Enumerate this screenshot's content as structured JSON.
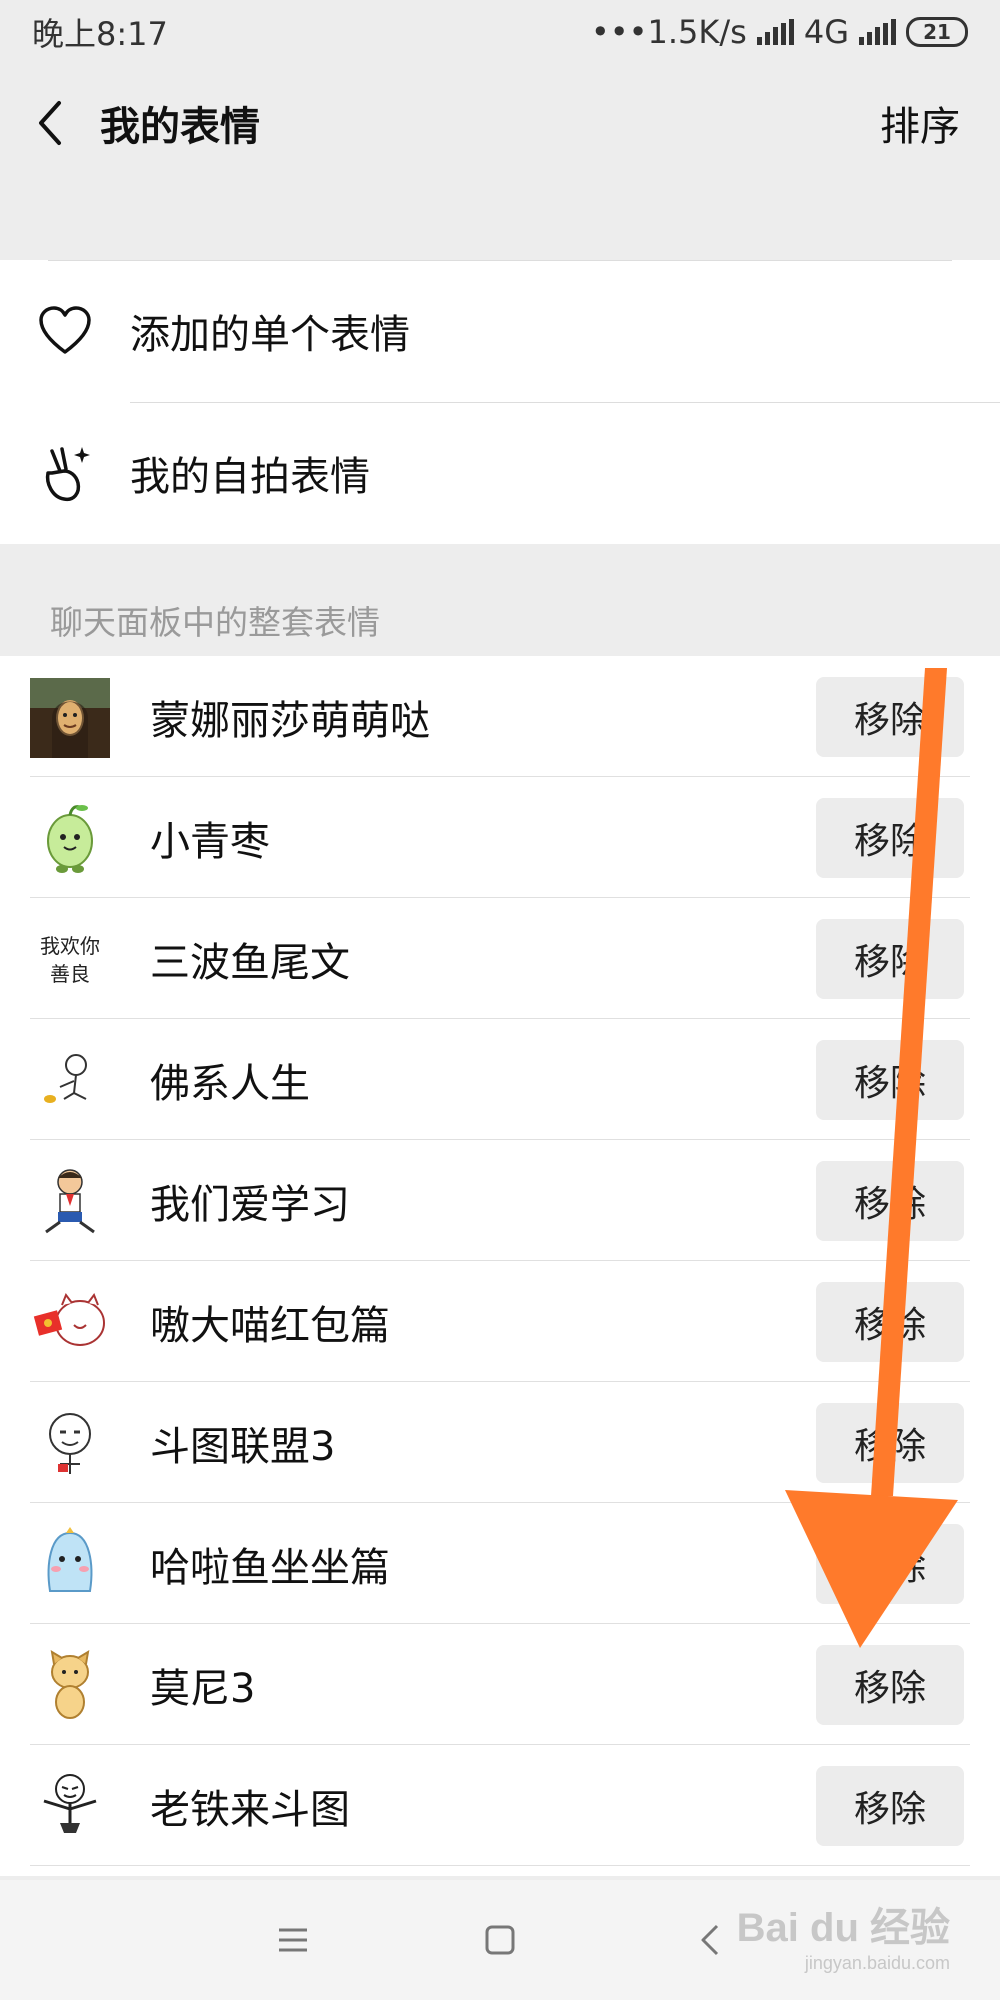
{
  "status_bar": {
    "time": "晚上8:17",
    "network_speed": "•••1.5K/s",
    "network_type": "4G",
    "battery": "21"
  },
  "header": {
    "title": "我的表情",
    "sort_label": "排序"
  },
  "menu": {
    "single_emoji": "添加的单个表情",
    "selfie_emoji": "我的自拍表情"
  },
  "section_label": "聊天面板中的整套表情",
  "remove_label": "移除",
  "packs": [
    {
      "name": "蒙娜丽莎萌萌哒",
      "icon": "mona-lisa-thumbnail"
    },
    {
      "name": "小青枣",
      "icon": "green-date-character-thumbnail"
    },
    {
      "name": "三波鱼尾文",
      "icon": "handwriting-thumbnail",
      "thumb_text": "我欢你 善良"
    },
    {
      "name": "佛系人生",
      "icon": "sitting-figure-thumbnail"
    },
    {
      "name": "我们爱学习",
      "icon": "schoolboy-thumbnail"
    },
    {
      "name": "嗷大喵红包篇",
      "icon": "cat-red-envelope-thumbnail"
    },
    {
      "name": "斗图联盟3",
      "icon": "meme-face-thumbnail"
    },
    {
      "name": "哈啦鱼坐坐篇",
      "icon": "blue-fish-thumbnail"
    },
    {
      "name": "莫尼3",
      "icon": "yellow-dog-thumbnail"
    },
    {
      "name": "老铁来斗图",
      "icon": "stickman-thumbnail"
    }
  ],
  "watermark": {
    "brand": "Bai du 经验",
    "url": "jingyan.baidu.com"
  },
  "colors": {
    "background": "#ededed",
    "button_bg": "#ececec",
    "annotation_arrow": "#ff7a2b"
  }
}
